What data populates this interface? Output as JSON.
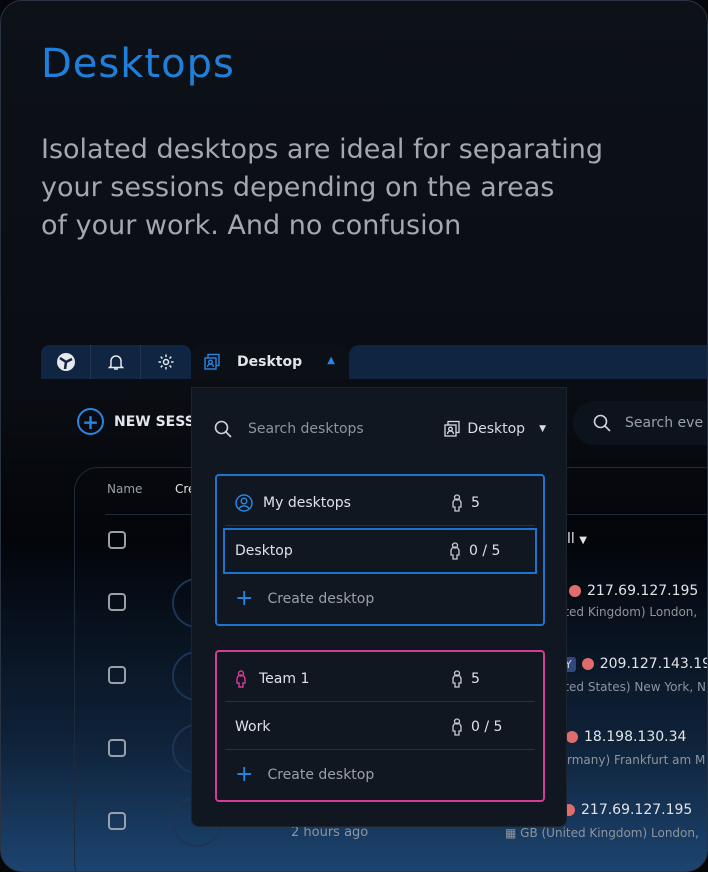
{
  "hero": {
    "title": "Desktops",
    "description_lines": [
      "Isolated desktops are ideal for separating",
      "your sessions depending on the areas",
      "of your work. And no confusion"
    ]
  },
  "topbar": {
    "icons": [
      "logo-icon",
      "bell-icon",
      "gear-icon"
    ],
    "desktop_tab": "Desktop"
  },
  "toolbar": {
    "new_session": "NEW SESSI",
    "search_events_placeholder": "Search eve"
  },
  "table": {
    "headers": [
      "Name",
      "Cre"
    ],
    "filter": "ll",
    "rows": [
      {
        "ip": "217.69.127.195",
        "location": "ited Kingdom) London,"
      },
      {
        "badge": "Y",
        "ip": "209.127.143.19",
        "location": "ited States) New York, N"
      },
      {
        "ip": "18.198.130.34",
        "location": "rmany) Frankfurt am M"
      },
      {
        "ip": "217.69.127.195",
        "location": "GB (United Kingdom) London,",
        "time": "2 hours ago"
      }
    ]
  },
  "dropdown": {
    "search_placeholder": "Search desktops",
    "selected": "Desktop",
    "groups": [
      {
        "name": "My desktops",
        "count": "5",
        "color": "#1e73d0",
        "desktops": [
          {
            "name": "Desktop",
            "count": "0 / 5",
            "selected": true
          }
        ],
        "create_label": "Create desktop"
      },
      {
        "name": "Team 1",
        "count": "5",
        "color": "#d33b94",
        "desktops": [
          {
            "name": "Work",
            "count": "0 / 5"
          }
        ],
        "create_label": "Create desktop"
      }
    ]
  },
  "colors": {
    "accent": "#1f80dc",
    "team": "#d33b94",
    "status_dot": "#e06c6c"
  }
}
